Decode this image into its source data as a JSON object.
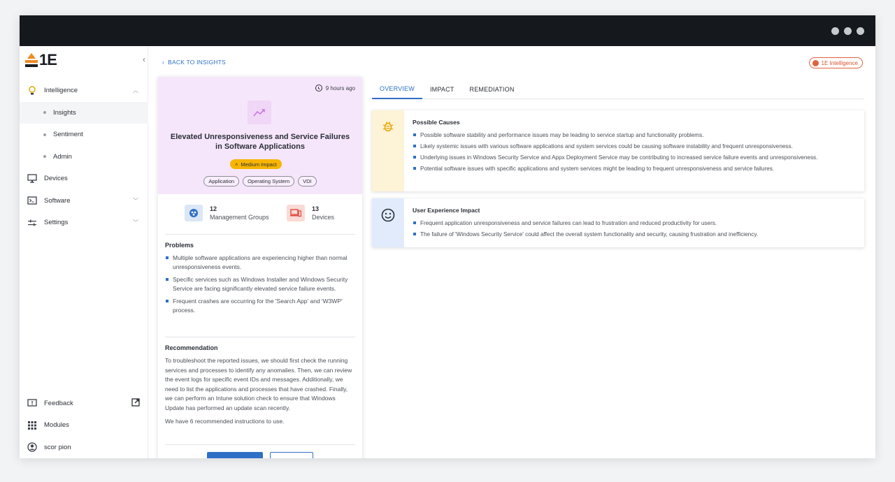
{
  "window": {
    "controls": [
      "dot-1",
      "dot-2",
      "dot-3"
    ]
  },
  "sidebar": {
    "logo_text": "1E",
    "collapse_icon": "chevron-left-icon",
    "items": [
      {
        "label": "Intelligence",
        "icon": "lightbulb-icon",
        "expanded": true
      },
      {
        "label": "Insights",
        "sub": true,
        "active": true
      },
      {
        "label": "Sentiment",
        "sub": true
      },
      {
        "label": "Admin",
        "sub": true
      },
      {
        "label": "Devices",
        "icon": "monitor-icon"
      },
      {
        "label": "Software",
        "icon": "terminal-icon",
        "expandable": true
      },
      {
        "label": "Settings",
        "icon": "sliders-icon",
        "expandable": true
      }
    ],
    "bottom": [
      {
        "label": "Feedback",
        "icon": "feedback-icon"
      },
      {
        "label": "Modules",
        "icon": "grid-icon"
      },
      {
        "label": "scor pion",
        "icon": "user-avatar-icon"
      }
    ]
  },
  "header": {
    "back_label": "BACK TO INSIGHTS",
    "brand_badge": "1E Intelligence"
  },
  "insight": {
    "time": "9 hours ago",
    "title": "Elevated Unresponsiveness and Service Failures in Software Applications",
    "impact": "Medium Impact",
    "tags": [
      "Application",
      "Operating System",
      "VDI"
    ],
    "stats": [
      {
        "value": "12",
        "label": "Management Groups"
      },
      {
        "value": "13",
        "label": "Devices"
      }
    ],
    "problems_title": "Problems",
    "problems": [
      "Multiple software applications are experiencing higher than normal unresponsiveness events.",
      "Specific services such as Windows Installer and Windows Security Service are facing significantly elevated service failure events.",
      "Frequent crashes are occurring for the 'Search App' and 'W3WP' process."
    ],
    "recommendation_title": "Recommendation",
    "recommendation": "To troubleshoot the reported issues, we should first check the running services and processes to identify any anomalies. Then, we can review the event logs for specific event IDs and messages. Additionally, we need to list the applications and processes that have crashed. Finally, we can perform an Intune solution check to ensure that Windows Update has performed an update scan recently.",
    "instructions_note": "We have 6 recommended instructions to use."
  },
  "tabs": [
    "OVERVIEW",
    "IMPACT",
    "REMEDIATION"
  ],
  "panels": {
    "causes": {
      "title": "Possible Causes",
      "items": [
        "Possible software stability and performance issues may be leading to service startup and functionality problems.",
        "Likely systemic issues with various software applications and system services could be causing software instability and frequent unresponsiveness.",
        "Underlying issues in Windows Security Service and Appx Deployment Service may be contributing to increased service failure events and unresponsiveness.",
        "Potential software issues with specific applications and system services might be leading to frequent unresponsiveness and service failures."
      ]
    },
    "ux": {
      "title": "User Experience Impact",
      "items": [
        "Frequent application unresponsiveness and service failures can lead to frustration and reduced productivity for users.",
        "The failure of 'Windows Security Service' could affect the overall system functionality and security, causing frustration and inefficiency."
      ]
    }
  },
  "colors": {
    "accent": "#2f6fc6",
    "impact_medium": "#f7b500",
    "card_header": "#f6e6fb",
    "causes_side": "#fdf3d6",
    "ux_side": "#e1ebfb"
  }
}
